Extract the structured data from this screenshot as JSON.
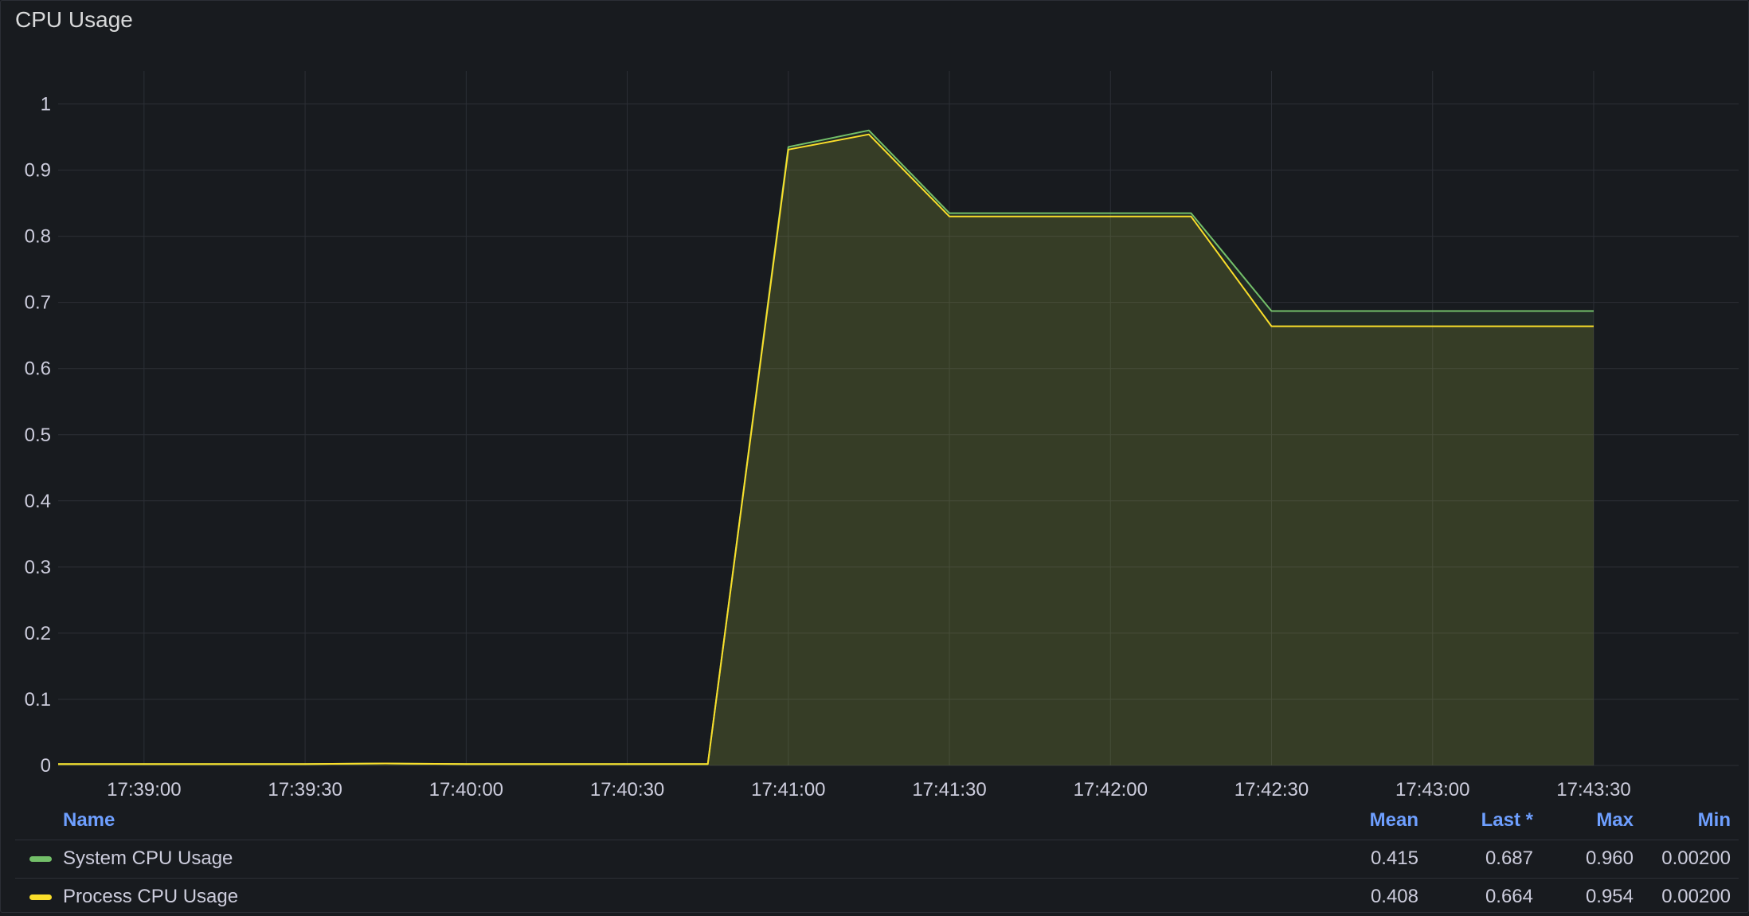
{
  "panel": {
    "title": "CPU Usage"
  },
  "colors": {
    "background": "#181b1f",
    "grid": "#2c2f36",
    "system": "#73bf69",
    "process": "#fade2a",
    "header_text": "#6e9fff"
  },
  "chart_data": {
    "type": "area",
    "y_ticks": [
      "0",
      "0.1",
      "0.2",
      "0.3",
      "0.4",
      "0.5",
      "0.6",
      "0.7",
      "0.8",
      "0.9",
      "1"
    ],
    "x_ticks": [
      "17:39:00",
      "17:39:30",
      "17:40:00",
      "17:40:30",
      "17:41:00",
      "17:41:30",
      "17:42:00",
      "17:42:30",
      "17:43:00",
      "17:43:30"
    ],
    "ylim": [
      0,
      1.05
    ],
    "xlim": [
      "17:38:44",
      "17:43:57"
    ],
    "grid": true,
    "legend_position": "bottom",
    "series": [
      {
        "name": "System CPU Usage",
        "color": "#73bf69",
        "points": [
          [
            "17:38:44",
            0.002
          ],
          [
            "17:39:00",
            0.002
          ],
          [
            "17:39:15",
            0.002
          ],
          [
            "17:39:30",
            0.002
          ],
          [
            "17:39:45",
            0.003
          ],
          [
            "17:40:00",
            0.002
          ],
          [
            "17:40:15",
            0.002
          ],
          [
            "17:40:30",
            0.002
          ],
          [
            "17:40:45",
            0.002
          ],
          [
            "17:41:00",
            0.935
          ],
          [
            "17:41:15",
            0.96
          ],
          [
            "17:41:30",
            0.835
          ],
          [
            "17:41:45",
            0.835
          ],
          [
            "17:42:00",
            0.835
          ],
          [
            "17:42:15",
            0.835
          ],
          [
            "17:42:30",
            0.687
          ],
          [
            "17:42:45",
            0.687
          ],
          [
            "17:43:00",
            0.687
          ],
          [
            "17:43:15",
            0.687
          ],
          [
            "17:43:30",
            0.687
          ]
        ]
      },
      {
        "name": "Process CPU Usage",
        "color": "#fade2a",
        "points": [
          [
            "17:38:44",
            0.002
          ],
          [
            "17:39:00",
            0.002
          ],
          [
            "17:39:15",
            0.002
          ],
          [
            "17:39:30",
            0.002
          ],
          [
            "17:39:45",
            0.003
          ],
          [
            "17:40:00",
            0.002
          ],
          [
            "17:40:15",
            0.002
          ],
          [
            "17:40:30",
            0.002
          ],
          [
            "17:40:45",
            0.002
          ],
          [
            "17:41:00",
            0.931
          ],
          [
            "17:41:15",
            0.954
          ],
          [
            "17:41:30",
            0.83
          ],
          [
            "17:41:45",
            0.83
          ],
          [
            "17:42:00",
            0.83
          ],
          [
            "17:42:15",
            0.83
          ],
          [
            "17:42:30",
            0.664
          ],
          [
            "17:42:45",
            0.664
          ],
          [
            "17:43:00",
            0.664
          ],
          [
            "17:43:15",
            0.664
          ],
          [
            "17:43:30",
            0.664
          ]
        ]
      }
    ]
  },
  "legend": {
    "headers": {
      "name": "Name",
      "mean": "Mean",
      "last": "Last *",
      "max": "Max",
      "min": "Min"
    },
    "rows": [
      {
        "name": "System CPU Usage",
        "color": "#73bf69",
        "mean": "0.415",
        "last": "0.687",
        "max": "0.960",
        "min": "0.00200"
      },
      {
        "name": "Process CPU Usage",
        "color": "#fade2a",
        "mean": "0.408",
        "last": "0.664",
        "max": "0.954",
        "min": "0.00200"
      }
    ]
  }
}
